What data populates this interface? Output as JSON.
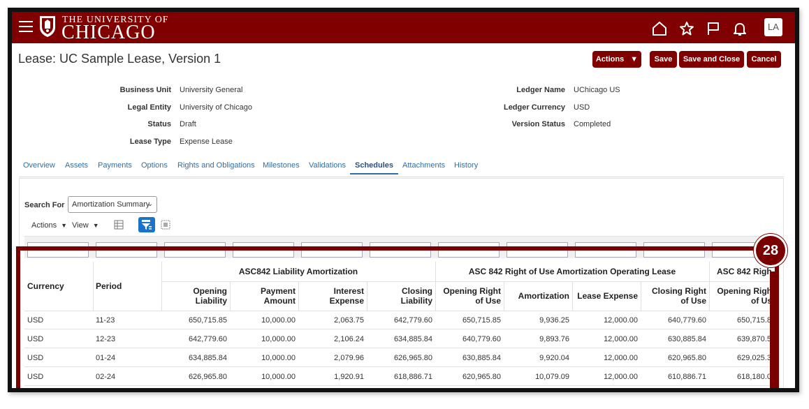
{
  "header": {
    "logo_small": "THE UNIVERSITY OF",
    "logo_big": "CHICAGO",
    "avatar": "LA",
    "brand_color": "#800000",
    "icons": [
      "home-icon",
      "star-icon",
      "flag-icon",
      "bell-icon"
    ]
  },
  "page": {
    "title": "Lease: UC Sample Lease, Version 1",
    "buttons": {
      "actions": "Actions",
      "save": "Save",
      "save_close": "Save and Close",
      "cancel": "Cancel"
    }
  },
  "fields": {
    "left": [
      {
        "label": "Business Unit",
        "value": "University General"
      },
      {
        "label": "Legal Entity",
        "value": "University of Chicago"
      },
      {
        "label": "Status",
        "value": "Draft"
      },
      {
        "label": "Lease Type",
        "value": "Expense Lease"
      }
    ],
    "right": [
      {
        "label": "Ledger Name",
        "value": "UChicago US"
      },
      {
        "label": "Ledger Currency",
        "value": "USD"
      },
      {
        "label": "Version Status",
        "value": "Completed"
      }
    ]
  },
  "tabs": [
    "Overview",
    "Assets",
    "Payments",
    "Options",
    "Rights and Obligations",
    "Milestones",
    "Validations",
    "Schedules",
    "Attachments",
    "History"
  ],
  "active_tab": "Schedules",
  "search": {
    "label": "Search For",
    "value": "Amortization Summary"
  },
  "toolbar": {
    "actions": "Actions",
    "view": "View"
  },
  "callout": "28",
  "table": {
    "group_headers": {
      "liability": "ASC842 Liability Amortization",
      "rou": "ASC 842 Right of Use Amortization Operating Lease",
      "rou2": "ASC 842 Righ"
    },
    "columns": {
      "currency": "Currency",
      "period": "Period",
      "c1a": "Opening",
      "c1b": "Liability",
      "c2a": "Payment",
      "c2b": "Amount",
      "c3a": "Interest",
      "c3b": "Expense",
      "c4a": "Closing",
      "c4b": "Liability",
      "c5a": "Opening Right",
      "c5b": "of Use",
      "c6": "Amortization",
      "c7": "Lease Expense",
      "c8a": "Closing Right",
      "c8b": "of Use",
      "c9a": "Opening Righ",
      "c9b": "of Us"
    },
    "rows": [
      [
        "USD",
        "11-23",
        "650,715.85",
        "10,000.00",
        "2,063.75",
        "642,779.60",
        "650,715.85",
        "9,936.25",
        "12,000.00",
        "640,779.60",
        "650,715.8"
      ],
      [
        "USD",
        "12-23",
        "642,779.60",
        "10,000.00",
        "2,106.24",
        "634,885.84",
        "640,779.60",
        "9,893.76",
        "12,000.00",
        "630,885.84",
        "639,870.5"
      ],
      [
        "USD",
        "01-24",
        "634,885.84",
        "10,000.00",
        "2,079.96",
        "626,965.80",
        "630,885.84",
        "9,920.04",
        "12,000.00",
        "620,965.80",
        "629,025.3"
      ],
      [
        "USD",
        "02-24",
        "626,965.80",
        "10,000.00",
        "1,920.91",
        "618,886.71",
        "620,965.80",
        "10,079.09",
        "12,000.00",
        "610,886.71",
        "618,180.0"
      ]
    ]
  }
}
